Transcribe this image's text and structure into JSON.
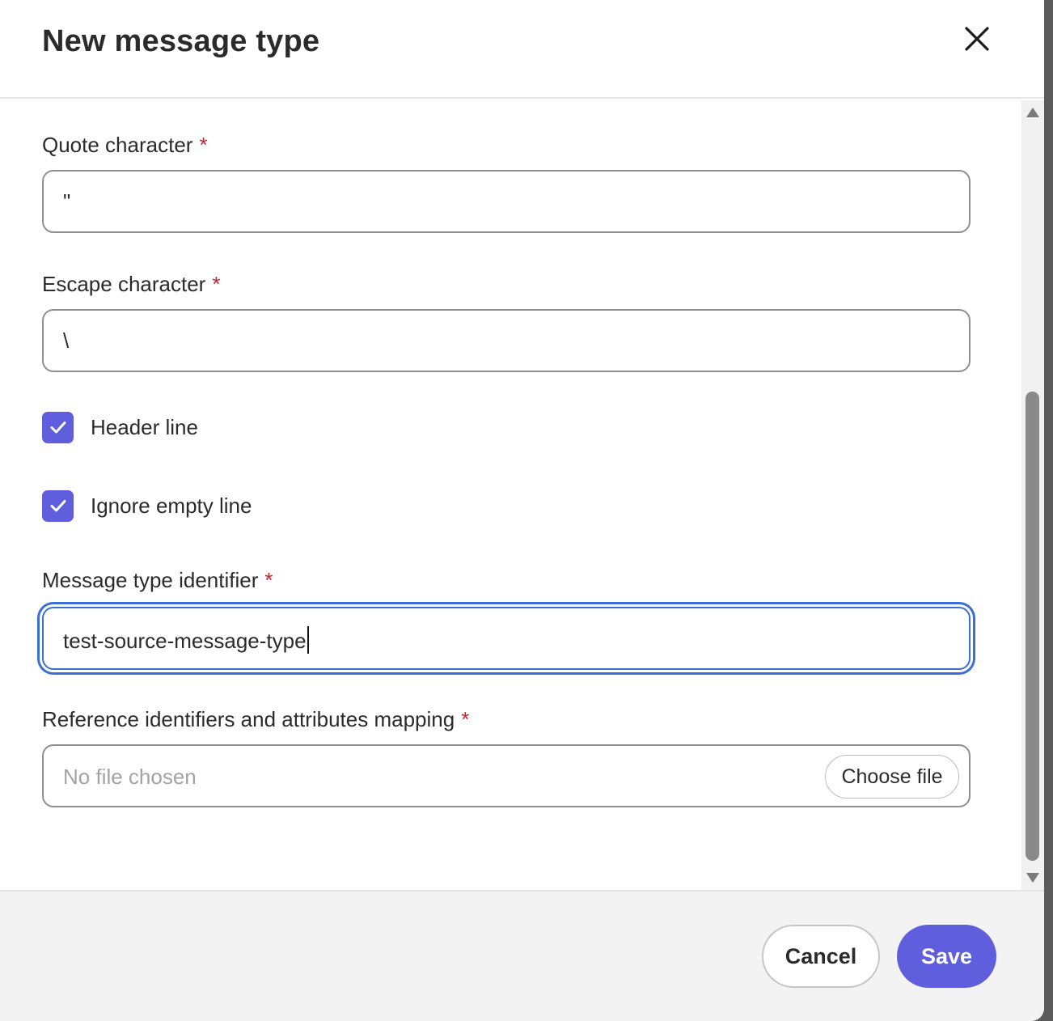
{
  "dialog": {
    "title": "New message type",
    "close_icon": "close-icon"
  },
  "form": {
    "quote": {
      "label": "Quote character",
      "required_mark": "*",
      "value": "\""
    },
    "escape": {
      "label": "Escape character",
      "required_mark": "*",
      "value": "\\"
    },
    "header_line": {
      "label": "Header line",
      "checked": true,
      "icon": "checkmark-icon"
    },
    "ignore_empty": {
      "label": "Ignore empty line",
      "checked": true,
      "icon": "checkmark-icon"
    },
    "identifier": {
      "label": "Message type identifier",
      "required_mark": "*",
      "value": "test-source-message-type"
    },
    "mapping": {
      "label": "Reference identifiers and attributes mapping",
      "required_mark": "*",
      "placeholder": "No file chosen",
      "button_label": "Choose file"
    }
  },
  "footer": {
    "cancel_label": "Cancel",
    "save_label": "Save"
  },
  "colors": {
    "accent": "#5f5fde",
    "required": "#c9252c",
    "focus": "#3b6fd4"
  }
}
